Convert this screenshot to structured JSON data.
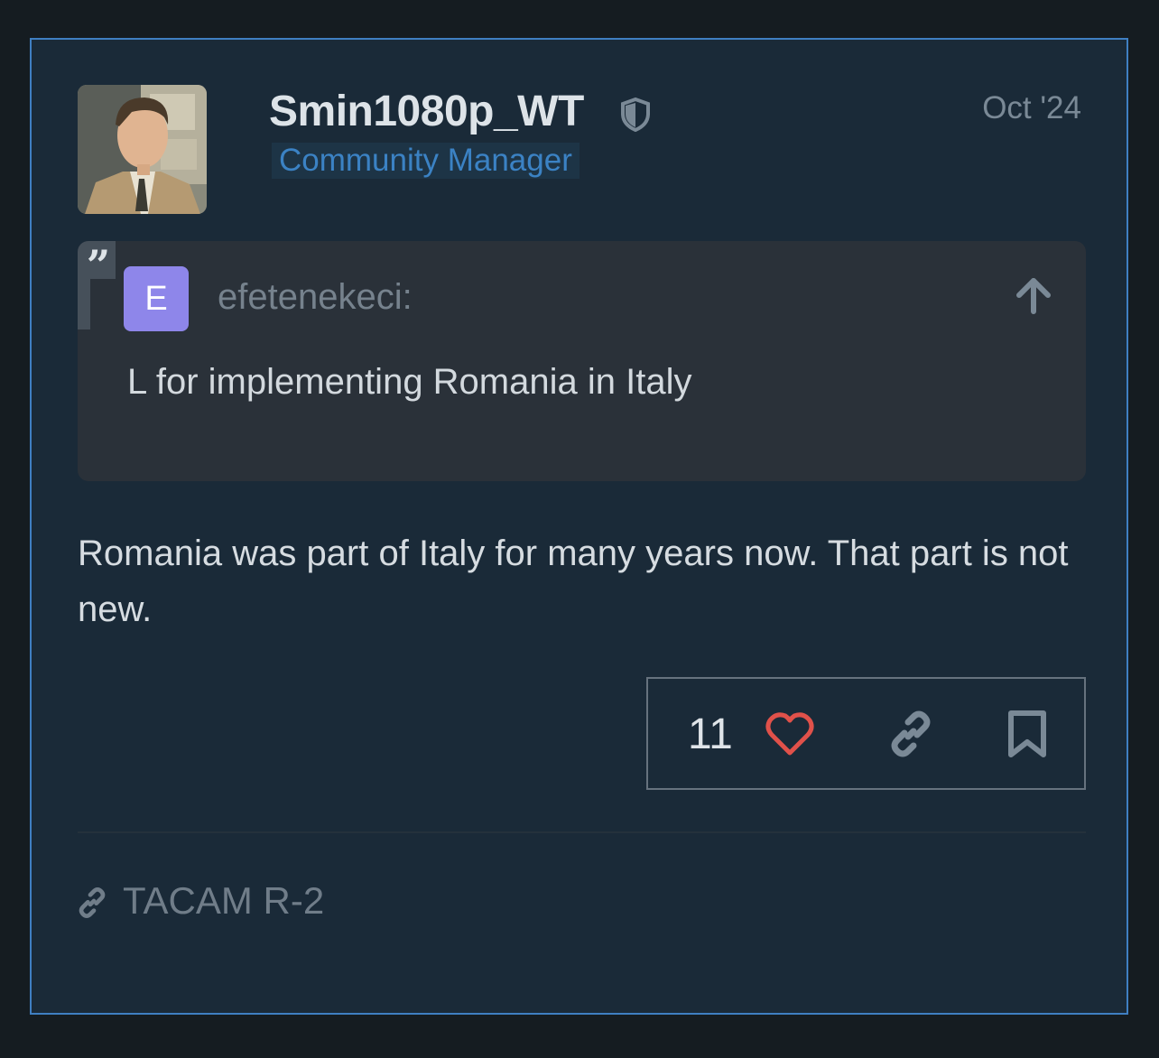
{
  "post": {
    "username": "Smin1080p_WT",
    "user_title": "Community Manager",
    "date": "Oct '24",
    "quote": {
      "avatar_letter": "E",
      "username": "efetenekeci:",
      "text": "L for implementing Romania in Italy"
    },
    "body": "Romania was part of Italy for many years now. That part is not new.",
    "actions": {
      "like_count": "11",
      "icons": [
        "heart-icon",
        "link-icon",
        "bookmark-icon"
      ]
    },
    "linked_topic": "TACAM R-2"
  },
  "colors": {
    "accent_border": "#3f7fc2",
    "user_title": "#3b82c4",
    "heart": "#e0514a",
    "quote_avatar": "#8e86ea"
  }
}
